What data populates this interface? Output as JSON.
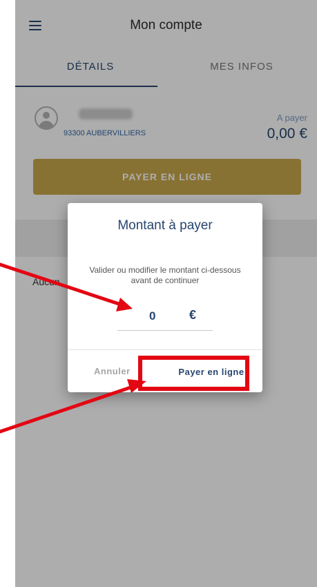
{
  "header": {
    "title": "Mon compte",
    "menu_icon": "menu-icon"
  },
  "tabs": [
    {
      "label": "DÉTAILS",
      "active": true
    },
    {
      "label": "MES INFOS",
      "active": false
    }
  ],
  "account": {
    "avatar_icon": "avatar-icon",
    "city": "93300 AUBERVILLIERS",
    "a_payer_label": "A payer",
    "amount": "0,00 €",
    "pay_button": "PAYER EN LIGNE"
  },
  "list": {
    "aucun_text": "Aucun"
  },
  "dialog": {
    "title": "Montant à payer",
    "text": "Valider ou modifier le montant ci-dessous avant de continuer",
    "amount_value": "0",
    "currency": "€",
    "cancel_label": "Annuler",
    "confirm_label": "Payer en ligne"
  },
  "colors": {
    "primary": "#27466e",
    "gold": "#c9a84c",
    "annotation_red": "#e30613",
    "link_blue": "#3568a8"
  }
}
